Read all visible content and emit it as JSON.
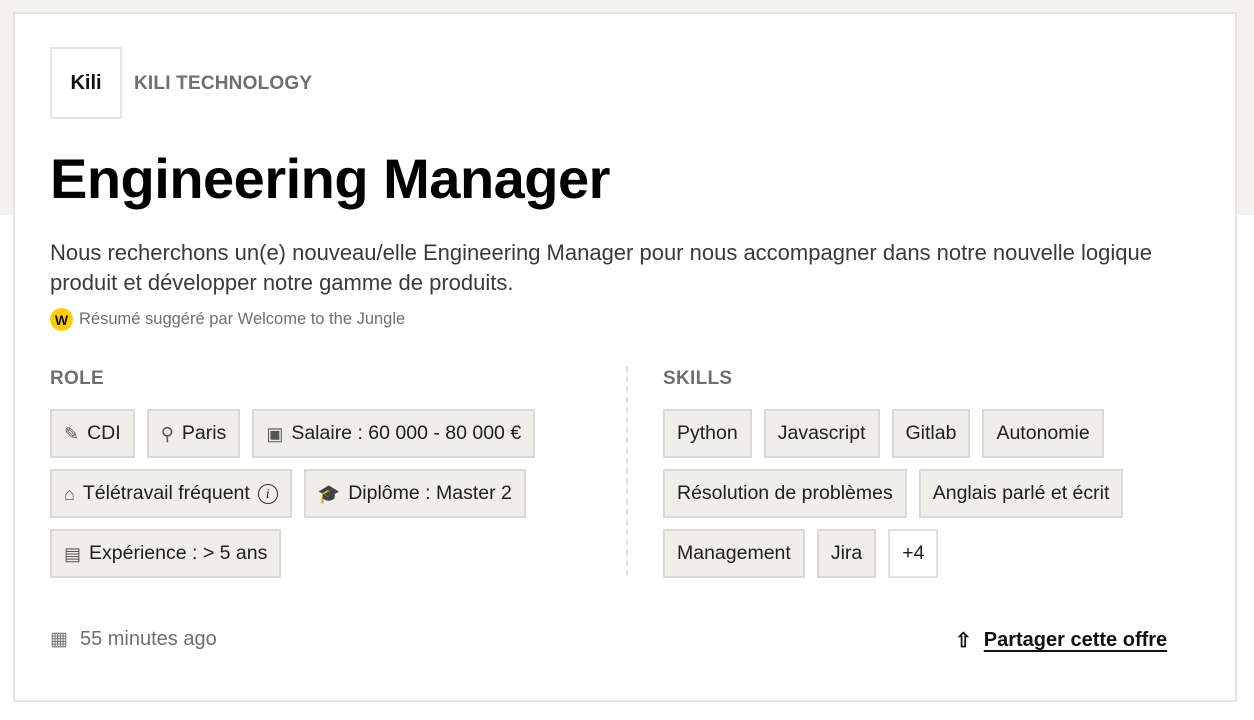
{
  "company": {
    "logo_text": "Kili",
    "name": "KILI TECHNOLOGY"
  },
  "job": {
    "title": "Engineering Manager",
    "description": "Nous recherchons un(e) nouveau/elle Engineering Manager pour nous accompagner dans notre nouvelle logique produit et développer notre gamme de produits.",
    "suggestion": {
      "icon": "W",
      "text": "Résumé suggéré par Welcome to the Jungle"
    }
  },
  "role": {
    "heading": "ROLE",
    "tags": [
      {
        "icon": "contract-icon",
        "glyph": "✎",
        "label": "CDI"
      },
      {
        "icon": "location-pin-icon",
        "glyph": "⚲",
        "label": "Paris"
      },
      {
        "icon": "banknote-icon",
        "glyph": "▣",
        "label": "Salaire : 60 000 - 80 000 €"
      },
      {
        "icon": "remote-work-icon",
        "glyph": "⌂",
        "label": "Télétravail fréquent"
      },
      {
        "icon": "graduation-cap-icon",
        "glyph": "🎓",
        "label": "Diplôme : Master 2"
      },
      {
        "icon": "briefcase-icon",
        "glyph": "▤",
        "label": "Expérience : > 5 ans"
      }
    ]
  },
  "skills": {
    "heading": "SKILLS",
    "tags": [
      "Python",
      "Javascript",
      "Gitlab",
      "Autonomie",
      "Résolution de problèmes",
      "Anglais parlé et écrit",
      "Management",
      "Jira"
    ],
    "more": "+4"
  },
  "footer": {
    "posted": "55 minutes ago",
    "share_label": "Partager cette offre"
  },
  "colors": {
    "tag_bg": "#f0eeea",
    "tag_border": "#dcd9d4",
    "accent_yellow": "#ffcd00",
    "band_bg": "#f4f2ef"
  }
}
